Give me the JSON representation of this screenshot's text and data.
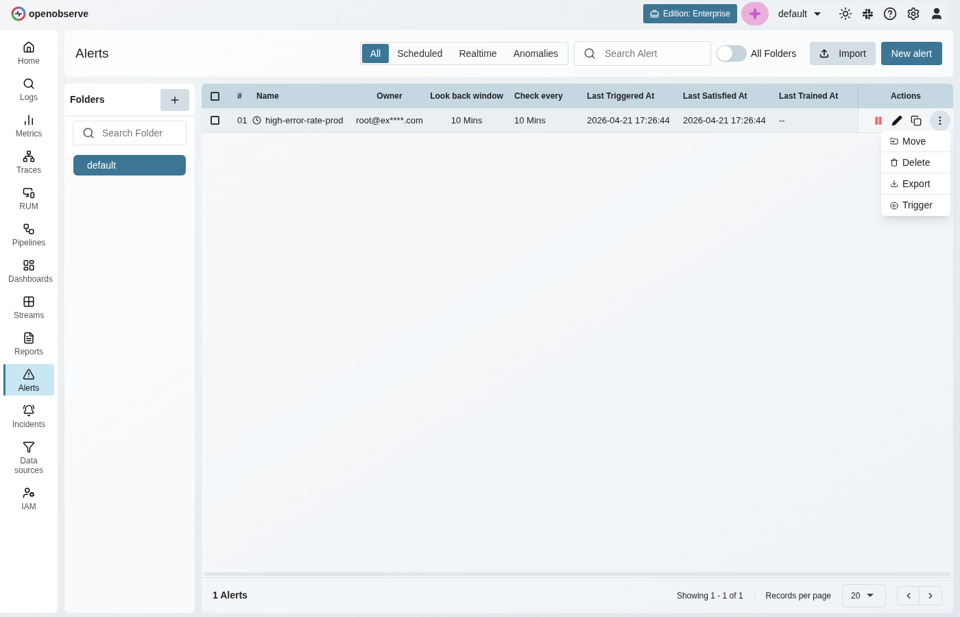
{
  "topbar": {
    "logo": "openobserve",
    "edition": "Edition: Enterprise",
    "org": "default"
  },
  "sidebar": {
    "items": [
      {
        "kind": "home",
        "label": "Home",
        "selected": false
      },
      {
        "kind": "logs",
        "label": "Logs",
        "selected": false
      },
      {
        "kind": "metrics",
        "label": "Metrics",
        "selected": false
      },
      {
        "kind": "traces",
        "label": "Traces",
        "selected": false
      },
      {
        "kind": "rum",
        "label": "RUM",
        "selected": false
      },
      {
        "kind": "pipelines",
        "label": "Pipelines",
        "selected": false
      },
      {
        "kind": "dashboards",
        "label": "Dashboards",
        "selected": false
      },
      {
        "kind": "streams",
        "label": "Streams",
        "selected": false
      },
      {
        "kind": "reports",
        "label": "Reports",
        "selected": false
      },
      {
        "kind": "alerts",
        "label": "Alerts",
        "selected": true
      },
      {
        "kind": "incidents",
        "label": "Incidents",
        "selected": false
      },
      {
        "kind": "sources",
        "label": "Data sources",
        "selected": false
      },
      {
        "kind": "iam",
        "label": "IAM",
        "selected": false
      }
    ]
  },
  "header": {
    "title": "Alerts",
    "tabs": [
      {
        "label": "All",
        "selected": true
      },
      {
        "label": "Scheduled",
        "selected": false
      },
      {
        "label": "Realtime",
        "selected": false
      },
      {
        "label": "Anomalies",
        "selected": false
      }
    ],
    "search": {
      "placeholder": "Search Alert"
    },
    "all_folders": {
      "label": "All Folders",
      "on": false
    },
    "import": "Import",
    "new_alert": "New alert"
  },
  "folders": {
    "title": "Folders",
    "search": {
      "placeholder": "Search Folder"
    },
    "items": [
      {
        "label": "default",
        "selected": true
      }
    ]
  },
  "table": {
    "select_all": {
      "checked": false
    },
    "columns": [
      "#",
      "Name",
      "Owner",
      "Look back window",
      "Check every",
      "Last Triggered At",
      "Last Satisfied At",
      "Last Trained At",
      "Actions"
    ],
    "rows": [
      {
        "checked": false,
        "index": "01",
        "name": "high-error-rate-prod",
        "owner": "root@ex****.com",
        "look_back": "10 Mins",
        "check_every": "10 Mins",
        "last_triggered": "2026-04-21 17:26:44",
        "last_satisfied": "2026-04-21 17:26:44",
        "last_trained": "--"
      }
    ]
  },
  "row_menu": {
    "items": [
      {
        "kind": "move",
        "label": "Move"
      },
      {
        "kind": "delete",
        "label": "Delete"
      },
      {
        "kind": "export",
        "label": "Export"
      },
      {
        "kind": "trigger",
        "label": "Trigger"
      }
    ]
  },
  "footer": {
    "count": "1 Alerts",
    "showing": "Showing 1 - 1 of 1",
    "records_label": "Records per page",
    "per_page": "20"
  }
}
